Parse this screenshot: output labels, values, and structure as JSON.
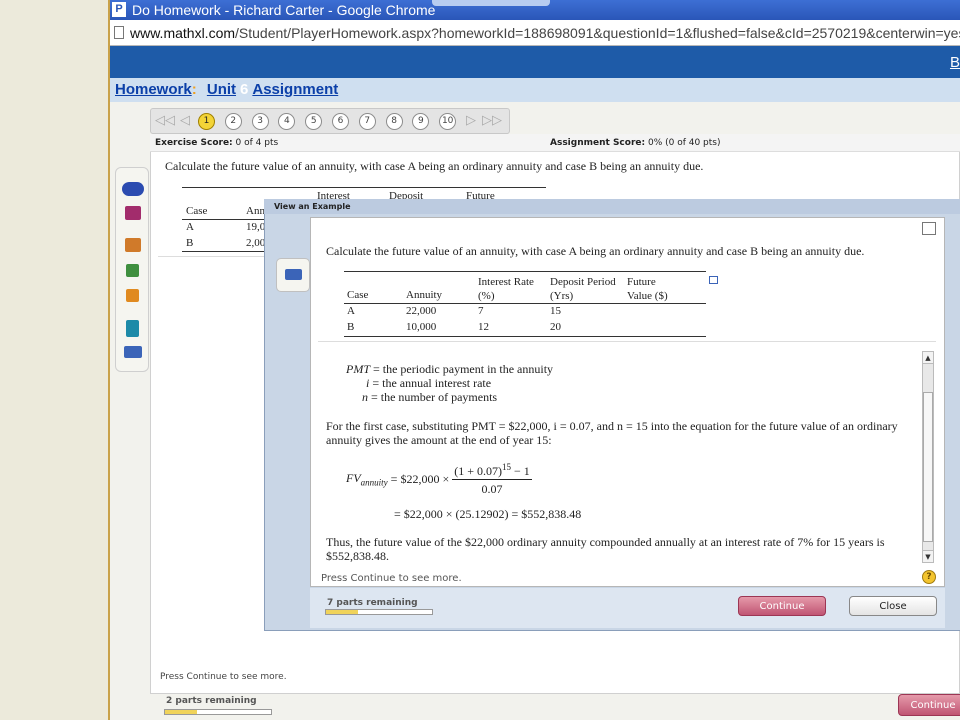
{
  "window": {
    "title": "Do Homework - Richard Carter - Google Chrome",
    "url_domain": "www.mathxl.com",
    "url_path": "/Student/PlayerHomework.aspx?homeworkId=188698091&questionId=1&flushed=false&cId=2570219&centerwin=yes"
  },
  "top_link": "B",
  "nav": {
    "homework": "Homework",
    "colon": ":",
    "unit": "Unit",
    "unit_number": "6",
    "assignment": "Assignment"
  },
  "question_nav": {
    "numbers": [
      "1",
      "2",
      "3",
      "4",
      "5",
      "6",
      "7",
      "8",
      "9",
      "10"
    ],
    "active": "1"
  },
  "scores": {
    "exercise_label": "Exercise Score:",
    "exercise_value": "0 of 4 pts",
    "assignment_label": "Assignment Score:",
    "assignment_value": "0% (0 of 40 pts)"
  },
  "question": {
    "text": "Calculate the future value of an annuity, with case A being an ordinary annuity and case B being an annuity due.",
    "partial_headers": [
      "Case",
      "Ann",
      "Interest",
      "Deposit",
      "Future"
    ],
    "partial_rows": [
      [
        "A",
        "19,0"
      ],
      [
        "B",
        "2,00"
      ]
    ]
  },
  "modal": {
    "title": "View an Example",
    "question_text": "Calculate the future value of an annuity, with case A being an ordinary annuity and case B being an annuity due.",
    "table": {
      "headers": [
        "Case",
        "Annuity",
        "Interest Rate (%)",
        "Deposit Period (Yrs)",
        "Future Value ($)"
      ],
      "rows": [
        [
          "A",
          "22,000",
          "7",
          "15",
          ""
        ],
        [
          "B",
          "10,000",
          "12",
          "20",
          ""
        ]
      ]
    },
    "definitions": [
      {
        "sym": "PMT",
        "text": " = the periodic payment in the annuity"
      },
      {
        "sym": "i",
        "text": " = the annual interest rate"
      },
      {
        "sym": "n",
        "text": " = the number of payments"
      }
    ],
    "para1": "For the first case, substituting PMT = $22,000, i = 0.07, and n = 15 into the equation for the future value of an ordinary annuity gives the amount at the end of year 15:",
    "eq_lhs": "FV",
    "eq_lhs_sub": "annuity",
    "eq_mid": "= $22,000 ×",
    "eq_num": "(1 + 0.07)",
    "eq_num_exp": "15",
    "eq_num_tail": " − 1",
    "eq_den": "0.07",
    "eq_line2": "= $22,000 × (25.12902) = $552,838.48",
    "para2": "Thus, the future value of the $22,000 ordinary annuity compounded annually at an interest rate of 7% for 15 years is $552,838.48.",
    "status": "Press Continue to see more.",
    "parts_remaining": "7 parts remaining",
    "progress": 0.3,
    "continue_label": "Continue",
    "close_label": "Close"
  },
  "bottom": {
    "status": "Press Continue to see more.",
    "parts_remaining": "2 parts remaining",
    "progress": 0.3,
    "continue_label": "Continue"
  },
  "colors": {
    "brand_blue": "#1e5ba8",
    "continue": "#c05573",
    "active_question": "#f3d437"
  }
}
